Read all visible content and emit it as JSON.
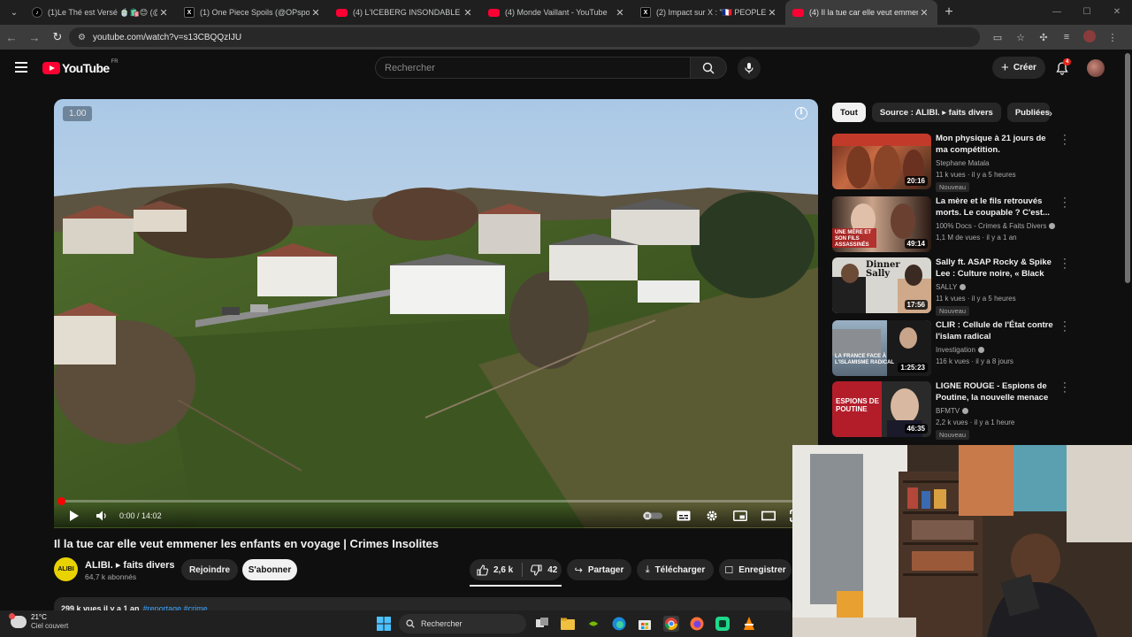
{
  "browser": {
    "tabs": [
      {
        "title": "(1)Le Thé est Versé 🍵🛍️😊 (@",
        "favicon": "tiktok-icon",
        "active": false
      },
      {
        "title": "(1) One Piece Spoils (@OPspoils",
        "favicon": "x-icon",
        "active": false
      },
      {
        "title": "(4) L'ICEBERG INSONDABLE de",
        "favicon": "youtube-icon",
        "active": false
      },
      {
        "title": "(4) Monde Vaillant - YouTube",
        "favicon": "youtube-icon",
        "active": false
      },
      {
        "title": "(2) Impact sur X : \"🇫🇷 PEOPLE | A",
        "favicon": "x-icon",
        "active": false
      },
      {
        "title": "(4) Il la tue car elle veut emmener",
        "favicon": "youtube-icon",
        "active": true
      }
    ],
    "url": "youtube.com/watch?v=s13CBQQzIJU"
  },
  "masthead": {
    "logo_text": "YouTube",
    "country_code": "FR",
    "search_placeholder": "Rechercher",
    "create_label": "Créer",
    "notification_count": "4"
  },
  "player": {
    "speed_badge": "1.00",
    "current_time": "0:00",
    "duration": "14:02",
    "progress_fraction": 0.0
  },
  "video": {
    "title": "Il la tue car elle veut emmener les enfants en voyage | Crimes Insolites",
    "channel_avatar_text": "ALIBI",
    "channel_name": "ALIBI. ▸ faits divers",
    "subscribers": "64,7 k abonnés",
    "join_label": "Rejoindre",
    "subscribe_label": "S'abonner",
    "likes": "2,6 k",
    "dislikes": "42",
    "share_label": "Partager",
    "download_label": "Télécharger",
    "save_label": "Enregistrer",
    "description_stats": "299 k vues  il y a 1 an",
    "description_tags": "#reportage #crime"
  },
  "chips": [
    {
      "label": "Tout",
      "active": true
    },
    {
      "label": "Source : ALIBI. ▸ faits divers",
      "active": false
    },
    {
      "label": "Publiées r",
      "active": false
    }
  ],
  "recommendations": [
    {
      "title": "Mon physique à 21 jours de ma compétition.",
      "channel": "Stephane Matala",
      "verified": false,
      "meta": "11 k vues · il y a 5 heures",
      "duration": "20:16",
      "badge": "Nouveau",
      "thumb_text": "",
      "accent": "#c23a2a"
    },
    {
      "title": "La mère et le fils retrouvés morts. Le coupable ? C'est...",
      "channel": "100% Docs - Crimes & Faits Divers",
      "verified": true,
      "meta": "1,1 M de vues · il y a 1 an",
      "duration": "49:14",
      "badge": "",
      "thumb_text": "UNE MÈRE ET SON FILS ASSASSINÉS",
      "accent": "#b01e1e"
    },
    {
      "title": "Sally ft. ASAP Rocky & Spike Lee : Culture noire, « Black Girl...",
      "channel": "SALLY",
      "verified": true,
      "meta": "11 k vues · il y a 5 heures",
      "duration": "17:56",
      "badge": "Nouveau",
      "thumb_text": "Dinner Sally",
      "accent": "#c9c9c9"
    },
    {
      "title": "CLIR : Cellule de l'État contre l'islam radical",
      "channel": "Investigation",
      "verified": true,
      "meta": "116 k vues · il y a 8 jours",
      "duration": "1:25:23",
      "badge": "",
      "thumb_text": "LA FRANCE FACE À L'ISLAMISME RADICAL",
      "accent": "#5a6a7a"
    },
    {
      "title": "LIGNE ROUGE - Espions de Poutine, la nouvelle menace",
      "channel": "BFMTV",
      "verified": true,
      "meta": "2,2 k vues · il y a 1 heure",
      "duration": "46:35",
      "badge": "Nouveau",
      "thumb_text": "ESPIONS DE POUTINE",
      "accent": "#b31d2a"
    }
  ],
  "taskbar": {
    "temperature": "21°C",
    "condition": "Ciel couvert",
    "search_label": "Rechercher"
  },
  "colors": {
    "yt_red": "#ff0033",
    "bg": "#0f0f0f",
    "chip_bg": "#272727",
    "link_blue": "#3ea6ff"
  }
}
